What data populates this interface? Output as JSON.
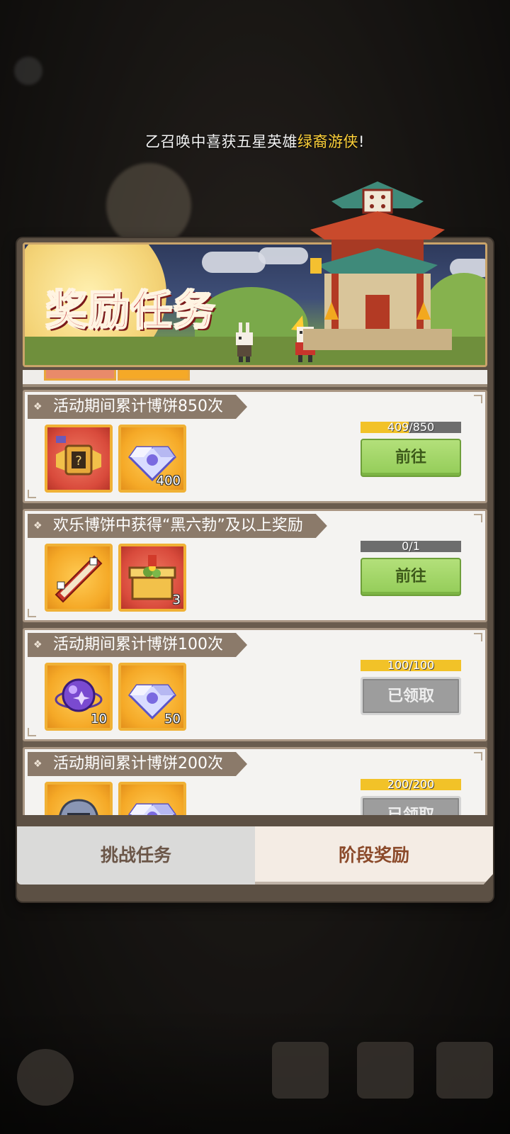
{
  "announcement": {
    "prefix": "乙召唤中喜获五星英雄",
    "hero": "绿裔游侠",
    "suffix": "!"
  },
  "banner": {
    "title": "奖励任务"
  },
  "tasks": [
    {
      "title": "活动期间累计博饼850次",
      "rewards": [
        {
          "icon": "mystery-chest-icon",
          "count": "",
          "style": "red"
        },
        {
          "icon": "diamond-icon",
          "count": "400",
          "style": "gold"
        }
      ],
      "progress_text": "409/850",
      "progress_fraction": 0.481,
      "button": "前往",
      "button_state": "go"
    },
    {
      "title": "欢乐博饼中获得“黑六勃”及以上奖励",
      "rewards": [
        {
          "icon": "scroll-ticket-icon",
          "count": "",
          "style": "gold"
        },
        {
          "icon": "gift-chest-icon",
          "count": "3",
          "style": "red"
        }
      ],
      "progress_text": "0/1",
      "progress_fraction": 0,
      "button": "前往",
      "button_state": "go"
    },
    {
      "title": "活动期间累计博饼100次",
      "rewards": [
        {
          "icon": "purple-orb-icon",
          "count": "10",
          "style": "gold"
        },
        {
          "icon": "diamond-icon",
          "count": "50",
          "style": "gold"
        }
      ],
      "progress_text": "100/100",
      "progress_fraction": 1,
      "button": "已领取",
      "button_state": "done"
    },
    {
      "title": "活动期间累计博饼200次",
      "rewards": [
        {
          "icon": "helmet-icon",
          "count": "",
          "style": "gold"
        },
        {
          "icon": "diamond-icon",
          "count": "",
          "style": "gold"
        }
      ],
      "progress_text": "200/200",
      "progress_fraction": 1,
      "button": "已领取",
      "button_state": "done"
    }
  ],
  "tabs": {
    "challenge": "挑战任务",
    "stage_rewards": "阶段奖励"
  },
  "colors": {
    "accent_gold": "#f2c228",
    "go_green": "#93cc58",
    "title_red": "#c0272d",
    "hero_highlight": "#ffd23a"
  }
}
